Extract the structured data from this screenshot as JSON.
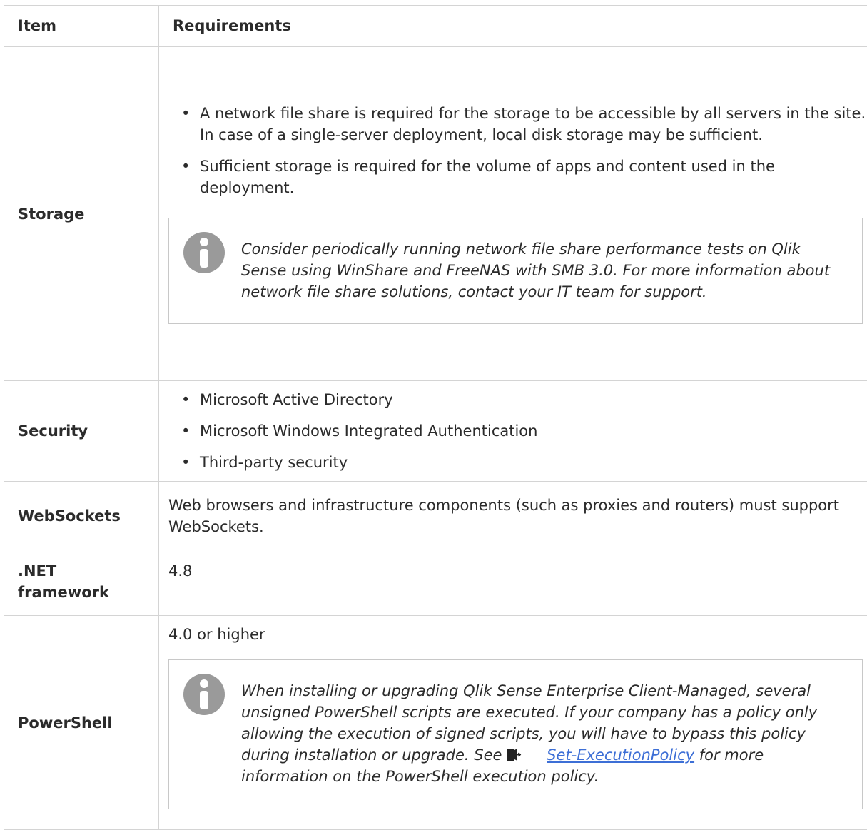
{
  "table": {
    "header": {
      "item": "Item",
      "requirements": "Requirements"
    },
    "rows": {
      "storage": {
        "item": "Storage",
        "bullets": [
          "A network file share is required for the storage to be accessible by all servers in the site. In case of a single-server deployment, local disk storage may be sufficient.",
          "Sufficient storage is required for the volume of apps and content used in the deployment."
        ],
        "note": "Consider periodically running network file share performance tests on Qlik Sense using WinShare and FreeNAS with SMB 3.0. For more information about network file share solutions, contact your IT team for support."
      },
      "security": {
        "item": "Security",
        "bullets": [
          "Microsoft Active Directory",
          "Microsoft Windows Integrated Authentication",
          "Third-party security"
        ]
      },
      "websockets": {
        "item": "WebSockets",
        "text": "Web browsers and infrastructure components (such as proxies and routers) must support WebSockets."
      },
      "dotnet": {
        "item": ".NET framework",
        "text": "4.8"
      },
      "powershell": {
        "item": "PowerShell",
        "text": "4.0 or higher",
        "note_before_link": "When installing or upgrading Qlik Sense Enterprise Client-Managed, several unsigned PowerShell scripts are executed. If your company has a policy only allowing the execution of signed scripts, you will have to bypass this policy during installation or upgrade. See",
        "link_text": "Set-ExecutionPolicy",
        "note_after_link": "for more information on the PowerShell execution policy."
      }
    }
  },
  "icons": {
    "note": "info-icon",
    "external_link": "external-link-icon"
  },
  "colors": {
    "border": "#d4d4d4",
    "info_icon": "#9a9a9a",
    "link": "#3d6fd6"
  }
}
